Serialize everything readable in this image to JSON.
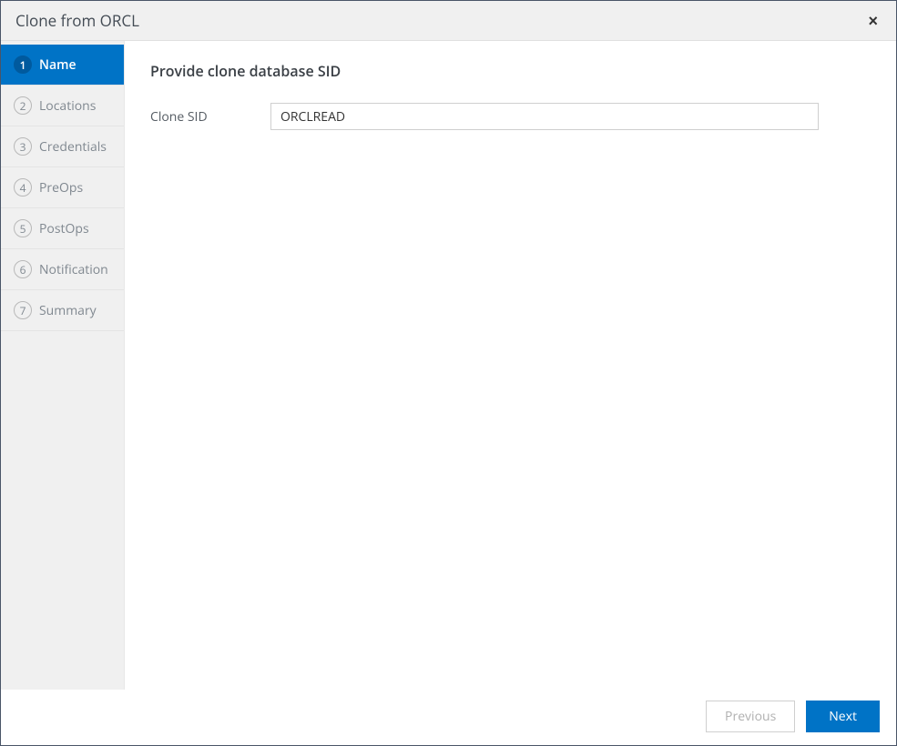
{
  "dialog": {
    "title": "Clone from ORCL",
    "close_label": "×"
  },
  "sidebar": {
    "steps": [
      {
        "num": "1",
        "label": "Name",
        "active": true
      },
      {
        "num": "2",
        "label": "Locations",
        "active": false
      },
      {
        "num": "3",
        "label": "Credentials",
        "active": false
      },
      {
        "num": "4",
        "label": "PreOps",
        "active": false
      },
      {
        "num": "5",
        "label": "PostOps",
        "active": false
      },
      {
        "num": "6",
        "label": "Notification",
        "active": false
      },
      {
        "num": "7",
        "label": "Summary",
        "active": false
      }
    ]
  },
  "main": {
    "heading": "Provide clone database SID",
    "clone_sid_label": "Clone SID",
    "clone_sid_value": "ORCLREAD"
  },
  "footer": {
    "previous_label": "Previous",
    "next_label": "Next"
  }
}
